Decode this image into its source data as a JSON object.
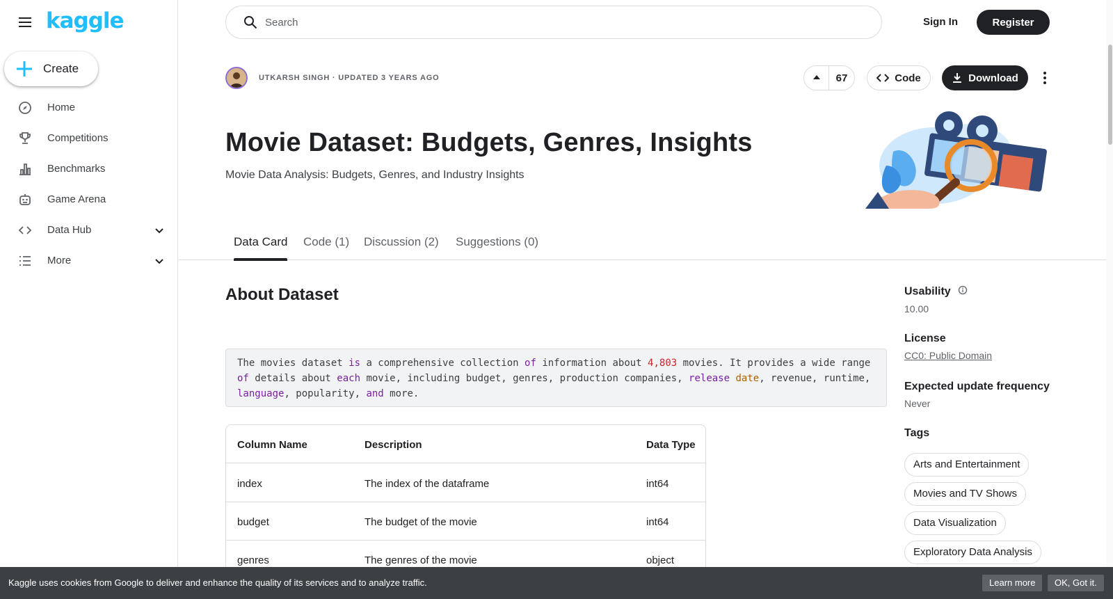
{
  "brand": {
    "logo": "kaggle",
    "accent": "#20beff"
  },
  "sidebar": {
    "create_label": "Create",
    "items": [
      {
        "label": "Home",
        "icon": "compass-icon"
      },
      {
        "label": "Competitions",
        "icon": "trophy-icon"
      },
      {
        "label": "Benchmarks",
        "icon": "bar-chart-icon"
      },
      {
        "label": "Game Arena",
        "icon": "robot-icon"
      },
      {
        "label": "Data Hub",
        "icon": "code-brackets-icon",
        "expandable": true
      },
      {
        "label": "More",
        "icon": "list-icon",
        "expandable": true
      }
    ]
  },
  "header": {
    "search_placeholder": "Search",
    "signin_label": "Sign In",
    "register_label": "Register"
  },
  "dataset": {
    "byline": "UTKARSH SINGH · UPDATED 3 YEARS AGO",
    "upvotes": "67",
    "code_label": "Code",
    "download_label": "Download",
    "title": "Movie Dataset: Budgets, Genres, Insights",
    "subtitle": "Movie Data Analysis: Budgets, Genres, and Industry Insights"
  },
  "tabs": [
    {
      "label": "Data Card",
      "active": true
    },
    {
      "label": "Code (1)",
      "active": false
    },
    {
      "label": "Discussion (2)",
      "active": false
    },
    {
      "label": "Suggestions (0)",
      "active": false
    }
  ],
  "about": {
    "heading": "About Dataset",
    "code_lines": [
      [
        [
          "The movies dataset ",
          ""
        ],
        [
          "is",
          "kw"
        ],
        [
          " a comprehensive collection ",
          ""
        ],
        [
          "of",
          "kw"
        ],
        [
          " information about ",
          ""
        ],
        [
          "4,803",
          "num"
        ],
        [
          " movies. It provides a wide range",
          ""
        ]
      ],
      [
        [
          "of",
          "kw"
        ],
        [
          " details about ",
          ""
        ],
        [
          "each",
          "kw"
        ],
        [
          " movie, including budget, genres, production companies, ",
          ""
        ],
        [
          "release",
          "kw"
        ],
        [
          " ",
          ""
        ],
        [
          "date",
          "fn"
        ],
        [
          ", revenue, runtime,",
          ""
        ]
      ],
      [
        [
          "language",
          "kw"
        ],
        [
          ", popularity, ",
          ""
        ],
        [
          "and",
          "kw"
        ],
        [
          " more.",
          ""
        ]
      ]
    ],
    "table": {
      "headers": [
        "Column Name",
        "Description",
        "Data Type"
      ],
      "rows": [
        [
          "index",
          "The index of the dataframe",
          "int64"
        ],
        [
          "budget",
          "The budget of the movie",
          "int64"
        ],
        [
          "genres",
          "The genres of the movie",
          "object"
        ]
      ]
    }
  },
  "side_panel": {
    "usability_label": "Usability",
    "usability_value": "10.00",
    "license_label": "License",
    "license_value": "CC0: Public Domain",
    "frequency_label": "Expected update frequency",
    "frequency_value": "Never",
    "tags_label": "Tags",
    "tags": [
      "Arts and Entertainment",
      "Movies and TV Shows",
      "Data Visualization",
      "Exploratory Data Analysis"
    ]
  },
  "cookie_banner": {
    "message": "Kaggle uses cookies from Google to deliver and enhance the quality of its services and to analyze traffic.",
    "learn_more": "Learn more",
    "ok": "OK, Got it."
  }
}
